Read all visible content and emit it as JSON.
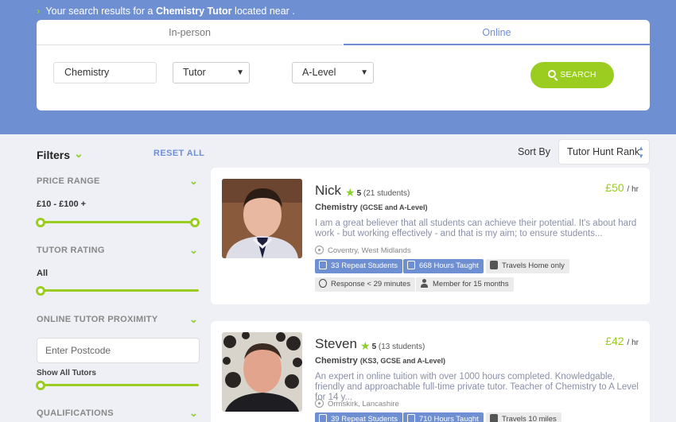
{
  "header": {
    "prefix": "Your search results for a",
    "query": "Chemistry Tutor",
    "suffix": "located near ."
  },
  "search": {
    "tabs": [
      "In-person",
      "Online"
    ],
    "active_tab": "Online",
    "subject_value": "Chemistry",
    "role_selected": "Tutor",
    "level_selected": "A-Level",
    "button_label": "SEARCH"
  },
  "filters": {
    "title": "Filters",
    "reset_label": "RESET ALL",
    "price_range": {
      "label": "PRICE RANGE",
      "value": "£10 - £100 +"
    },
    "tutor_rating": {
      "label": "TUTOR RATING",
      "value": "All"
    },
    "online_proximity": {
      "label": "ONLINE TUTOR PROXIMITY",
      "placeholder": "Enter Postcode",
      "show_all": "Show All Tutors"
    },
    "qualifications": {
      "label": "QUALIFICATIONS"
    }
  },
  "sort": {
    "label": "Sort By",
    "selected": "Tutor Hunt Rank"
  },
  "tutors": [
    {
      "name": "Nick",
      "rating": "5",
      "students": "(21 students)",
      "price": "£50",
      "per": "/ hr",
      "subject": "Chemistry",
      "levels": "(GCSE and A-Level)",
      "bio": "I am a great believer that all students can achieve their potential. It's about hard work - but working effectively - and that is my aim; to ensure students...",
      "location": "Coventry, West Midlands",
      "repeat": "33 Repeat Students",
      "hours": "668 Hours Taught",
      "travels": "Travels Home only",
      "response": "Response < 29 minutes",
      "member": "Member for 15 months"
    },
    {
      "name": "Steven",
      "rating": "5",
      "students": "(13 students)",
      "price": "£42",
      "per": "/ hr",
      "subject": "Chemistry",
      "levels": "(KS3, GCSE and A-Level)",
      "bio": "An expert in online tuition with over 1000 hours completed. Knowledgable, friendly and approachable full-time private tutor. Teacher of Chemistry to A Level for 14 y...",
      "location": "Ormskirk, Lancashire",
      "repeat": "39 Repeat Students",
      "hours": "710 Hours Taught",
      "travels": "Travels 10 miles"
    }
  ],
  "colors": {
    "brand_blue": "#6f8fd3",
    "accent_green": "#9acd1f"
  }
}
